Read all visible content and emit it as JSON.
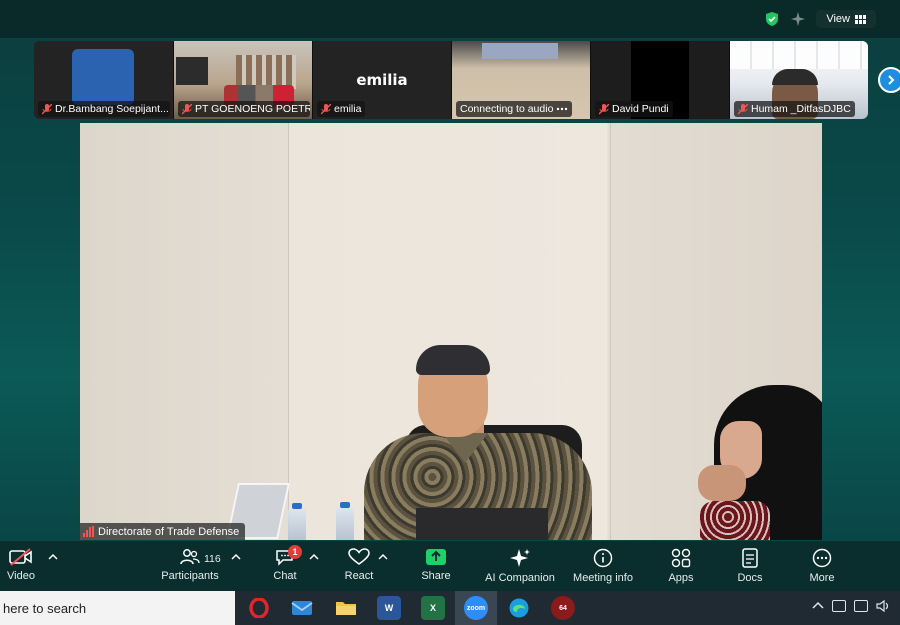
{
  "top_bar": {
    "view_label": "View",
    "icons": [
      "shield-check-icon",
      "sparkle-icon",
      "grid-view-icon"
    ]
  },
  "participants_strip": [
    {
      "name": "Dr.Bambang Soepijant...",
      "muted": true
    },
    {
      "name": "PT GOENOENG POETR...",
      "muted": true
    },
    {
      "name": "emilia",
      "muted": true,
      "display_name": "emilia"
    },
    {
      "name": "Connecting to audio",
      "muted": false
    },
    {
      "name": "David Pundi",
      "muted": true
    },
    {
      "name": "Humam _DitfasDJBC",
      "muted": true
    }
  ],
  "active_speaker": {
    "name": "Directorate of Trade Defense"
  },
  "toolbar": {
    "video_label": "Video",
    "participants_label": "Participants",
    "participants_count": "116",
    "chat_label": "Chat",
    "chat_badge": "1",
    "react_label": "React",
    "share_label": "Share",
    "ai_label": "AI Companion",
    "meeting_info_label": "Meeting info",
    "apps_label": "Apps",
    "docs_label": "Docs",
    "more_label": "More"
  },
  "taskbar": {
    "search_text": "here to search",
    "apps": [
      "opera-icon",
      "mail-icon",
      "file-explorer-icon",
      "word-icon",
      "excel-icon",
      "zoom-icon",
      "edge-icon",
      "game-icon"
    ],
    "zoom_label": "zoom",
    "word_label": "W",
    "excel_label": "X",
    "game_label": "64"
  },
  "colors": {
    "accent_green": "#22c55e",
    "share_green": "#1fd06a",
    "badge_red": "#e23c3c",
    "arrow_blue": "#1e8fe0"
  }
}
